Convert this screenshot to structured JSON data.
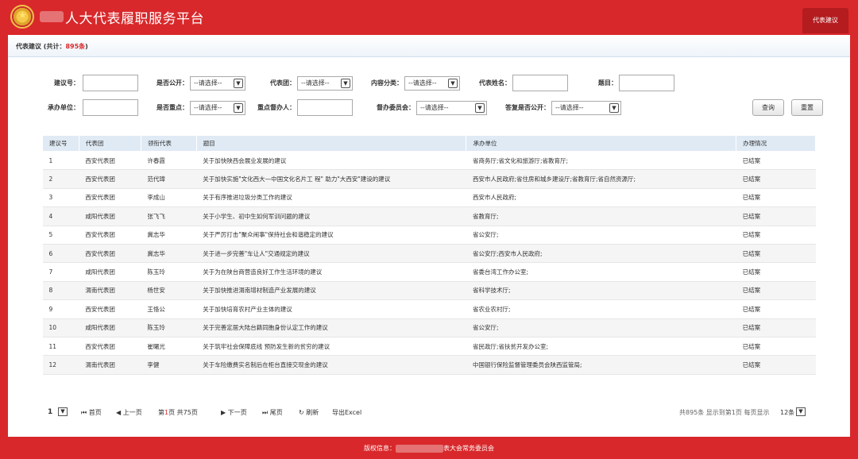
{
  "header": {
    "title": "人大代表履职服务平台",
    "tab": "代表建议"
  },
  "panel": {
    "heading_prefix": "代表建议 (共计：",
    "heading_count": "895条",
    "heading_suffix": ")"
  },
  "filters": {
    "proposal_no": {
      "label": "建议号："
    },
    "is_public": {
      "label": "是否公开：",
      "value": "--请选择--"
    },
    "delegation": {
      "label": "代表团：",
      "value": "--请选择--"
    },
    "category": {
      "label": "内容分类：",
      "value": "--请选择--"
    },
    "rep_name": {
      "label": "代表姓名："
    },
    "topic": {
      "label": "题目："
    },
    "handling_unit": {
      "label": "承办单位："
    },
    "is_key": {
      "label": "是否重点：",
      "value": "--请选择--"
    },
    "key_handler": {
      "label": "重点督办人："
    },
    "committee": {
      "label": "督办委员会：",
      "value": "--请选择--"
    },
    "reply_public": {
      "label": "答复是否公开：",
      "value": "--请选择--"
    },
    "search_label": "查询",
    "reset_label": "重置"
  },
  "table": {
    "columns": [
      "建议号",
      "代表团",
      "领衔代表",
      "题目",
      "承办单位",
      "办理情况"
    ],
    "rows": [
      [
        "1",
        "西安代表团",
        "许春霞",
        "关于加快陕西会展业发展的建议",
        "省商务厅;省文化和旅游厅;省教育厅;",
        "已结案"
      ],
      [
        "2",
        "西安代表团",
        "范代璋",
        "关于加快实施\"文化西大—中国文化名片工 程\" 助力\"大西安\"建设的建议",
        "西安市人民政府;省住房和城乡建设厅;省教育厅;省自然资源厅;",
        "已结案"
      ],
      [
        "3",
        "西安代表团",
        "李成山",
        "关于有序推进垃圾分类工作的建议",
        "西安市人民政府;",
        "已结案"
      ],
      [
        "4",
        "咸阳代表团",
        "张飞飞",
        "关于小学生、初中生如何军训问题的建议",
        "省教育厅;",
        "已结案"
      ],
      [
        "5",
        "西安代表团",
        "冀志华",
        "关于严厉打击\"聚众闹事\"保持社会和谐稳定的建议",
        "省公安厅;",
        "已结案"
      ],
      [
        "6",
        "西安代表团",
        "冀志华",
        "关于进一步完善\"车让人\"交通规定的建议",
        "省公安厅;西安市人民政府;",
        "已结案"
      ],
      [
        "7",
        "咸阳代表团",
        "陈玉玲",
        "关于为在陕台商营造良好工作生活环境的建议",
        "省委台湾工作办公室;",
        "已结案"
      ],
      [
        "8",
        "渭南代表团",
        "杨世安",
        "关于加快推进渭南增材制造产业发展的建议",
        "省科学技术厅;",
        "已结案"
      ],
      [
        "9",
        "西安代表团",
        "王恪公",
        "关于加快培育农村产业主体的建议",
        "省农业农村厅;",
        "已结案"
      ],
      [
        "10",
        "咸阳代表团",
        "陈玉玲",
        "关于完善定居大陆台籍同胞身份认定工作的建议",
        "省公安厅;",
        "已结案"
      ],
      [
        "11",
        "西安代表团",
        "崔曙光",
        "关于筑牢社会保障底线 预防发生新的贫穷的建议",
        "省民政厅;省扶贫开发办公室;",
        "已结案"
      ],
      [
        "12",
        "渭南代表团",
        "李健",
        "关于车险缴费实名制后在柜台直接交现金的建议",
        "中国银行保险监督管理委员会陕西监管局;",
        "已结案"
      ]
    ]
  },
  "pager": {
    "page_size_sel": "1",
    "first": "首页",
    "prev": "上一页",
    "page_prefix": "第",
    "page_current": "1",
    "page_mid": "页  共",
    "page_total": "75",
    "page_suffix": "页",
    "next": "下一页",
    "last": "尾页",
    "refresh": "刷新",
    "export": "导出Excel",
    "summary": "共895条 显示到第1页 每页显示",
    "per_page": "12条"
  },
  "footer": {
    "prefix": "版权信息：",
    "suffix": "表大会常务委员会"
  },
  "colors": {
    "brand_red": "#d8282b",
    "header_bg": "#dfeaf5"
  }
}
